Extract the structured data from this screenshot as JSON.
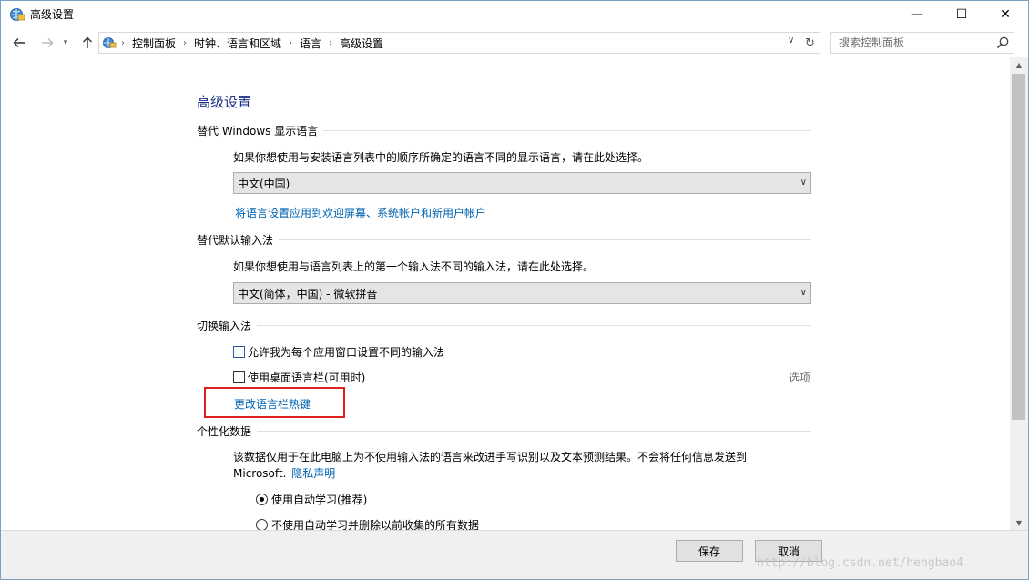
{
  "window": {
    "title": "高级设置",
    "minimize_label": "—",
    "maximize_label": "☐",
    "close_label": "✕"
  },
  "address": {
    "breadcrumbs": [
      "控制面板",
      "时钟、语言和区域",
      "语言",
      "高级设置"
    ],
    "search_placeholder": "搜索控制面板"
  },
  "page": {
    "title": "高级设置",
    "display_language": {
      "heading": "替代 Windows 显示语言",
      "description": "如果你想使用与安装语言列表中的顺序所确定的语言不同的显示语言，请在此处选择。",
      "selected": "中文(中国)",
      "link": "将语言设置应用到欢迎屏幕、系统帐户和新用户帐户"
    },
    "input_method": {
      "heading": "替代默认输入法",
      "description": "如果你想使用与语言列表上的第一个输入法不同的输入法，请在此处选择。",
      "selected": "中文(简体，中国) - 微软拼音"
    },
    "switch_input": {
      "heading": "切换输入法",
      "option1": "允许我为每个应用窗口设置不同的输入法",
      "option1_checked": false,
      "option2": "使用桌面语言栏(可用时)",
      "option2_checked": false,
      "options_link": "选项",
      "hotkey_link": "更改语言栏热键"
    },
    "personalization": {
      "heading": "个性化数据",
      "description_line1": "该数据仅用于在此电脑上为不使用输入法的语言来改进手写识别以及文本预测结果。不会将任何信息发送到",
      "description_line2_prefix": "Microsoft.",
      "privacy_link": "隐私声明",
      "radio1": "使用自动学习(推荐)",
      "radio1_checked": true,
      "radio2": "不使用自动学习并删除以前收集的所有数据",
      "radio2_checked": false
    }
  },
  "footer": {
    "save_label": "保存",
    "cancel_label": "取消",
    "watermark": "http://blog.csdn.net/hengbao4"
  },
  "colors": {
    "accent_title": "#1e3287",
    "link": "#0063b1",
    "highlight": "#e02020"
  }
}
